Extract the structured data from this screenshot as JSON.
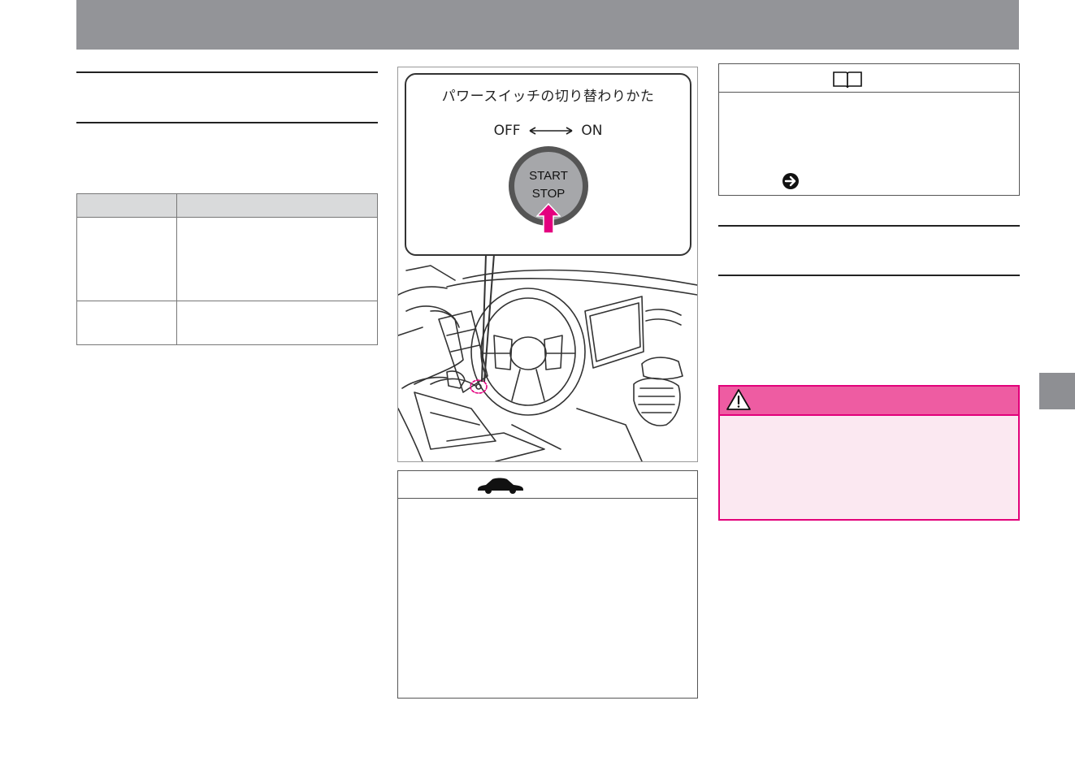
{
  "illustration": {
    "callout_title": "パワースイッチの切り替わりかた",
    "off_label": "OFF",
    "on_label": "ON",
    "button_line1": "START",
    "button_line2": "STOP"
  },
  "icons": {
    "car": "car-icon",
    "book": "book-icon",
    "arrow": "arrow-right-circle-icon",
    "warning": "warning-triangle-icon"
  },
  "colors": {
    "header": "#939498",
    "warning_border": "#e2007a",
    "warning_header": "#ee5ca2",
    "warning_body": "#fbe8f1",
    "highlight_arrow": "#e4007f"
  }
}
